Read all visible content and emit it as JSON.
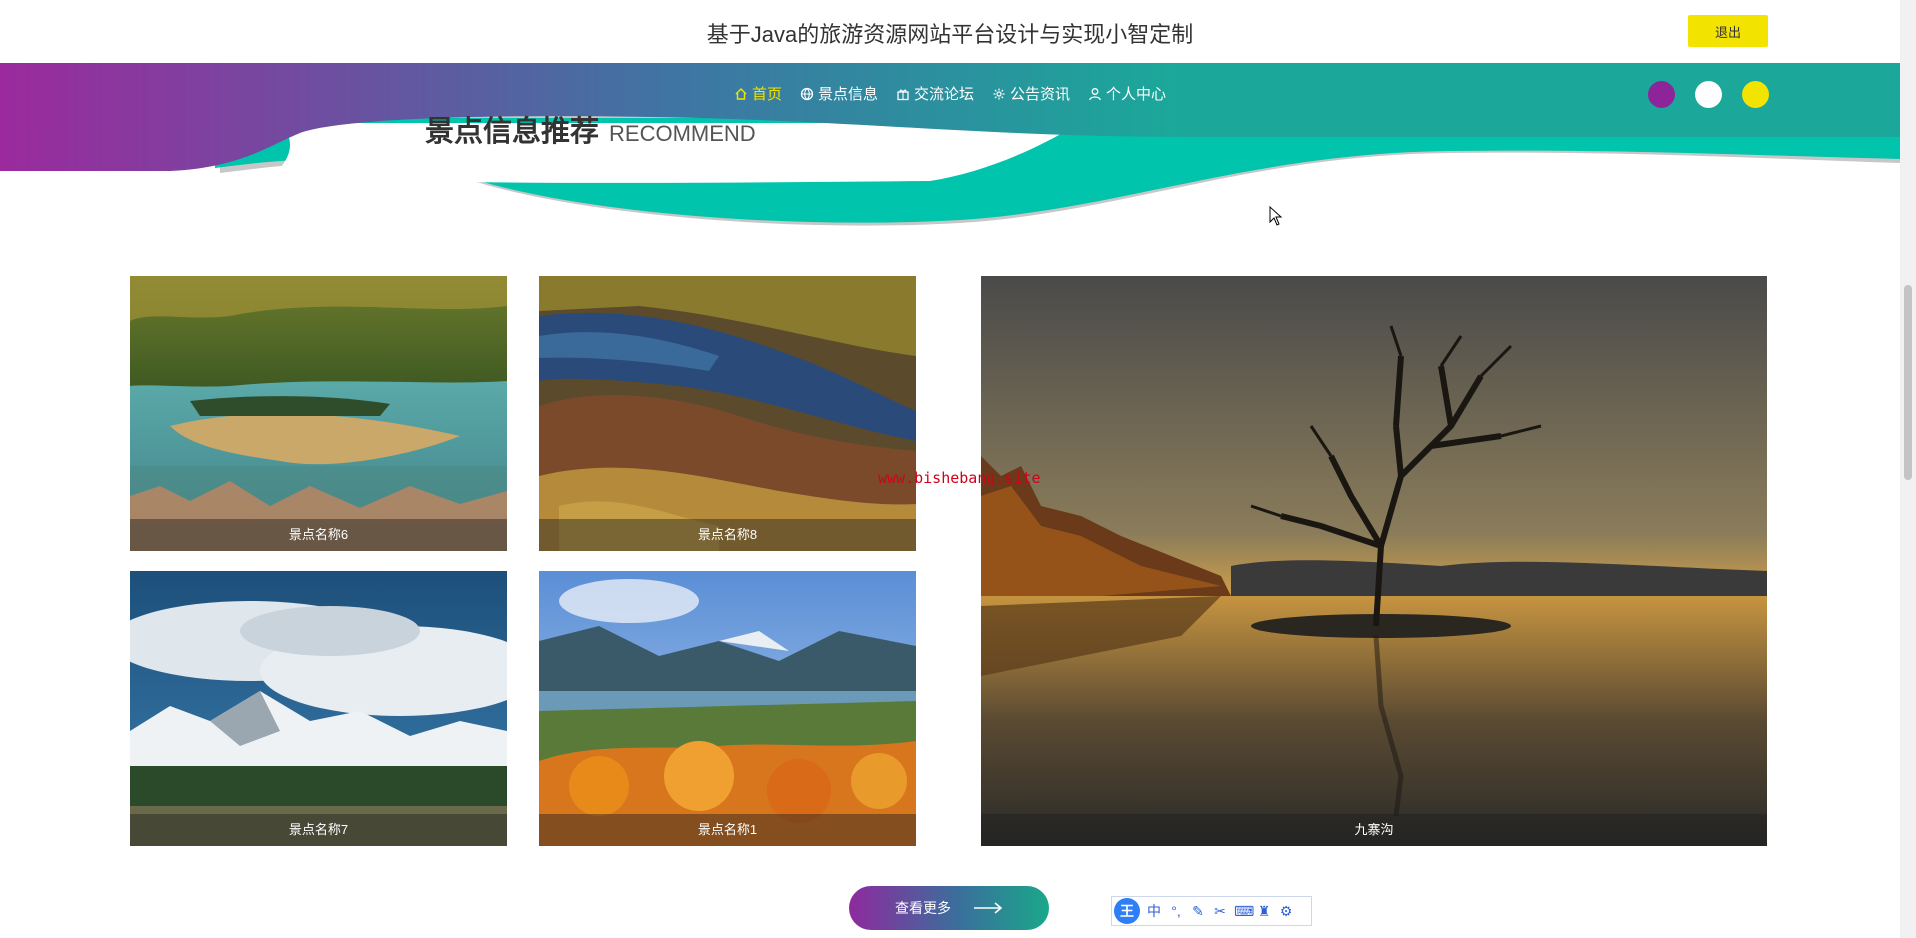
{
  "header": {
    "site_title": "基于Java的旅游资源网站平台设计与实现小智定制",
    "logout_label": "退出"
  },
  "nav": {
    "items": [
      {
        "label": "首页",
        "icon": "home-icon",
        "active": true
      },
      {
        "label": "景点信息",
        "icon": "globe-icon",
        "active": false
      },
      {
        "label": "交流论坛",
        "icon": "gift-icon",
        "active": false
      },
      {
        "label": "公告资讯",
        "icon": "settings-icon",
        "active": false
      },
      {
        "label": "个人中心",
        "icon": "user-icon",
        "active": false
      }
    ],
    "theme_colors": [
      "#8e249a",
      "#ffffff",
      "#f3e300"
    ]
  },
  "section": {
    "title_zh": "景点信息推荐",
    "title_en": "RECOMMEND"
  },
  "cards": [
    {
      "name": "景点名称6"
    },
    {
      "name": "景点名称8"
    },
    {
      "name": "景点名称7"
    },
    {
      "name": "景点名称1"
    },
    {
      "name": "九寨沟"
    }
  ],
  "watermark": "www.bishebang.site",
  "more_button": {
    "label": "查看更多"
  },
  "colors": {
    "nav_start": "#9b2a9d",
    "nav_end": "#1ba89a",
    "accent": "#f3e300",
    "wave_teal": "#00c4ac"
  }
}
